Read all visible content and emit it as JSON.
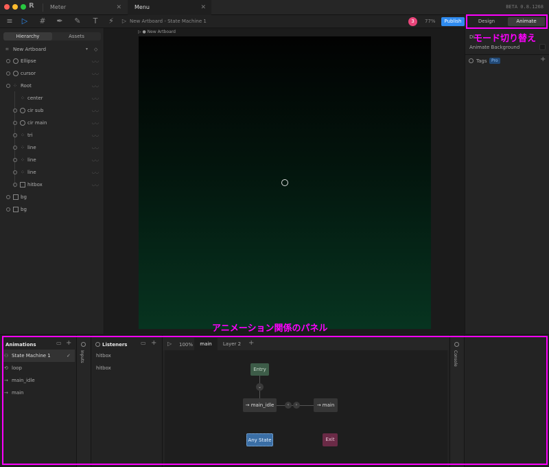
{
  "window": {
    "tabs": [
      {
        "label": "Meter"
      },
      {
        "label": "Menu"
      }
    ],
    "version": "BETA 0.8.1268"
  },
  "toolbar": {
    "breadcrumb": "New Artboard - State Machine 1",
    "user_badge": "3",
    "zoom": "77%",
    "publish_label": "Publish"
  },
  "hierarchy": {
    "tabs": [
      "Hierarchy",
      "Assets"
    ],
    "artboard": "New Artboard",
    "items": [
      {
        "label": "Ellipse"
      },
      {
        "label": "cursor"
      },
      {
        "label": "Root"
      },
      {
        "label": "center"
      },
      {
        "label": "cir sub"
      },
      {
        "label": "cir main"
      },
      {
        "label": "tri"
      },
      {
        "label": "line"
      },
      {
        "label": "line"
      },
      {
        "label": "line"
      },
      {
        "label": "hitbox"
      },
      {
        "label": "bg"
      },
      {
        "label": "bg"
      }
    ]
  },
  "canvas": {
    "artboard_label": "New Artboard"
  },
  "right_panel": {
    "mode_tabs": [
      "Design",
      "Animate"
    ],
    "di_label": "Di",
    "animate_background": "Animate Background",
    "tags_label": "Tags",
    "tag_pill": "Pro"
  },
  "animations": {
    "title": "Animations",
    "items": [
      {
        "label": "State Machine 1"
      },
      {
        "label": "loop"
      },
      {
        "label": "main_idle"
      },
      {
        "label": "main"
      }
    ]
  },
  "inputs": {
    "label": "Inputs"
  },
  "listeners": {
    "title": "Listeners",
    "items": [
      {
        "label": "hitbox"
      },
      {
        "label": "hitbox"
      }
    ]
  },
  "state_machine": {
    "zoom": "100%",
    "layers": [
      {
        "label": "main"
      },
      {
        "label": "Layer 2"
      }
    ],
    "nodes": {
      "entry": "Entry",
      "main_idle": "main_idle",
      "main": "main",
      "any_state": "Any State",
      "exit": "Exit"
    }
  },
  "console": {
    "label": "Console"
  },
  "annotations": {
    "mode_switch": "モード切り替え",
    "animation_panel": "アニメーション関係のパネル"
  },
  "colors": {
    "accent": "#2f8bf0",
    "annotation": "#ff00ff",
    "entry_node": "#3d5c48",
    "exit_node": "#6a2a46",
    "any_state_node": "#3a6ea5"
  }
}
